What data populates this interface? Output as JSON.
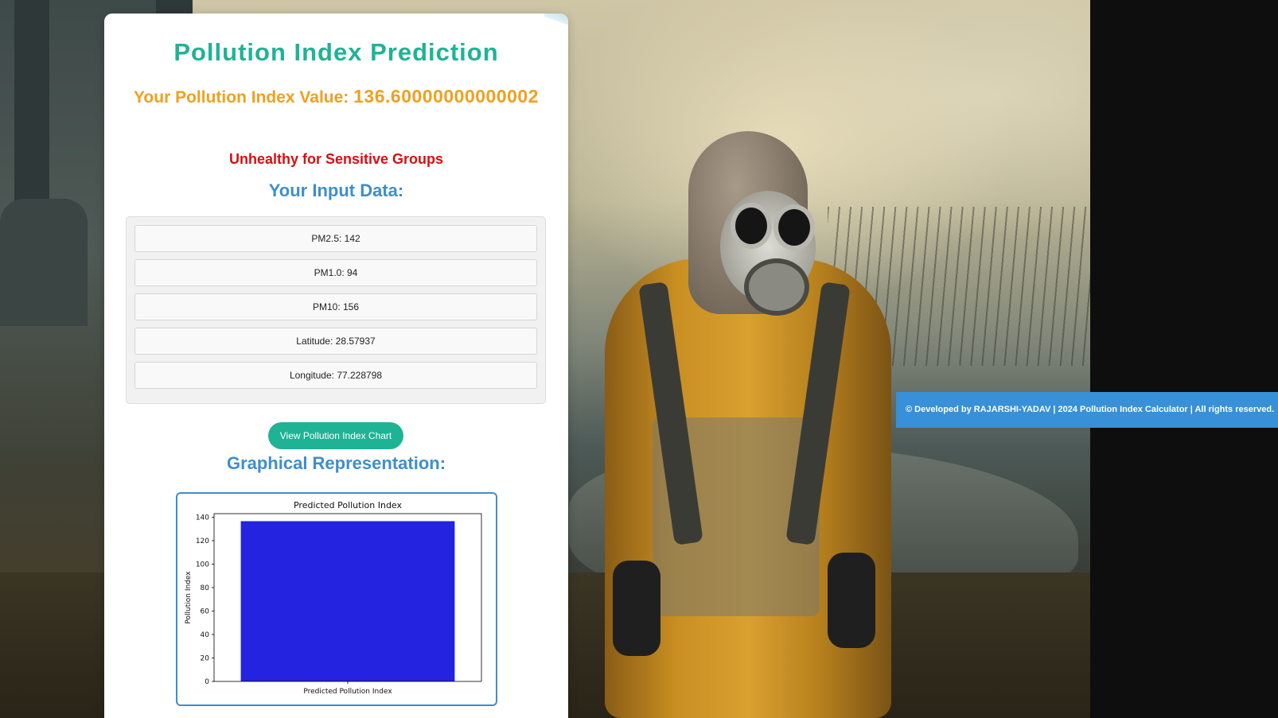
{
  "page": {
    "title": "Pollution Index Prediction",
    "value_label": "Your Pollution Index Value:",
    "value": "136.60000000000002",
    "category": "Unhealthy for Sensitive Groups",
    "input_heading": "Your Input Data:",
    "inputs": [
      "PM2.5: 142",
      "PM1.0: 94",
      "PM10: 156",
      "Latitude: 28.57937",
      "Longitude: 77.228798"
    ],
    "chart_button": "View Pollution Index Chart",
    "graph_heading": "Graphical Representation:"
  },
  "footer": {
    "text": "© Developed by RAJARSHI-YADAV | 2024 Pollution Index Calculator | All rights reserved."
  },
  "colors": {
    "title": "#1fb395",
    "value": "#f0a020",
    "category": "#d80f0f",
    "heading": "#3d8fcc",
    "bar": "#2323e0",
    "footer": "#3790d8"
  },
  "chart_data": {
    "type": "bar",
    "title": "Predicted Pollution Index",
    "xlabel": "Predicted Pollution Index",
    "ylabel": "Pollution Index",
    "categories": [
      ""
    ],
    "values": [
      136.6
    ],
    "ylim": [
      0,
      143
    ],
    "yticks": [
      0,
      20,
      40,
      60,
      80,
      100,
      120,
      140
    ],
    "grid": false
  }
}
